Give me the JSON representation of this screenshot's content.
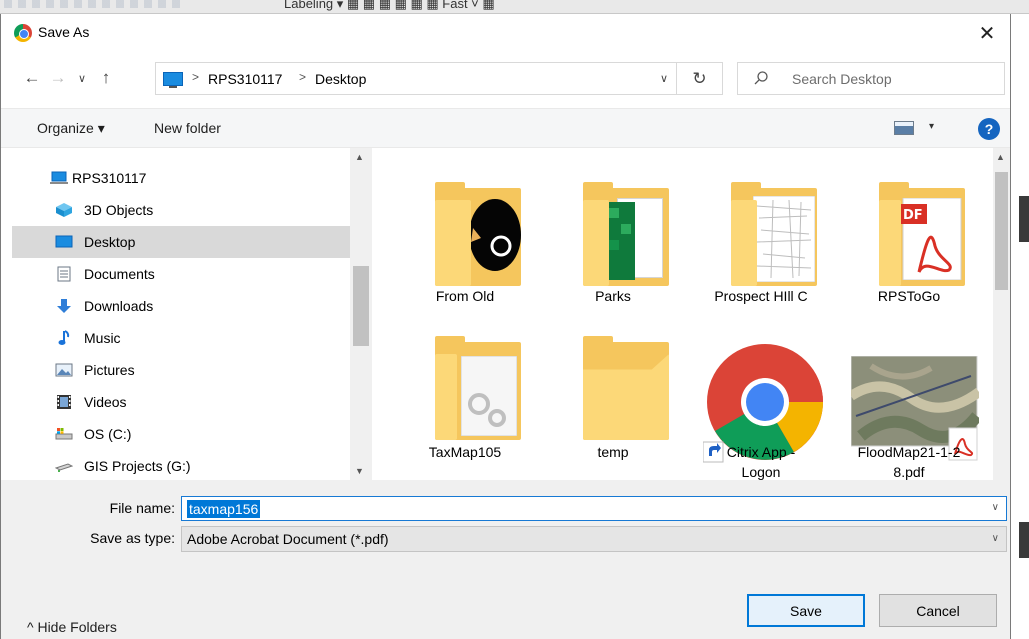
{
  "backdrop": {
    "text": "Labeling ▾   ▦  ▦  ▦  ▦  ▦  ▦  Fast     ˅ ▦"
  },
  "window": {
    "title": "Save As",
    "close_label": "✕"
  },
  "address_bar": {
    "crumbs": [
      "RPS310117",
      "Desktop"
    ],
    "separator": ">",
    "back_icon": "←",
    "forward_icon": "→",
    "dropdown_icon": "∨",
    "up_icon": "↑",
    "refresh_icon": "↻",
    "expand_icon": "∨"
  },
  "search": {
    "placeholder": "Search Desktop"
  },
  "toolbar": {
    "organize_label": "Organize ▾",
    "new_folder_label": "New folder",
    "help_label": "?",
    "view_drop": "▾"
  },
  "nav_pane": {
    "items": [
      {
        "label": "RPS310117",
        "icon": "computer-icon",
        "selected": false
      },
      {
        "label": "3D Objects",
        "icon": "cube-icon",
        "selected": false
      },
      {
        "label": "Desktop",
        "icon": "desktop-icon",
        "selected": true
      },
      {
        "label": "Documents",
        "icon": "document-icon",
        "selected": false
      },
      {
        "label": "Downloads",
        "icon": "download-icon",
        "selected": false
      },
      {
        "label": "Music",
        "icon": "music-icon",
        "selected": false
      },
      {
        "label": "Pictures",
        "icon": "pictures-icon",
        "selected": false
      },
      {
        "label": "Videos",
        "icon": "videos-icon",
        "selected": false
      },
      {
        "label": "OS (C:)",
        "icon": "drive-icon",
        "selected": false
      },
      {
        "label": "GIS Projects (G:)",
        "icon": "network-drive-icon",
        "selected": false
      }
    ]
  },
  "files": [
    {
      "label": "From Old",
      "icon": "folder-icon"
    },
    {
      "label": "Parks",
      "icon": "folder-icon"
    },
    {
      "label": "Prospect HIll C",
      "icon": "folder-icon"
    },
    {
      "label": "RPSToGo",
      "icon": "folder-icon"
    },
    {
      "label": "TaxMap105",
      "icon": "folder-icon"
    },
    {
      "label": "temp",
      "icon": "folder-icon"
    },
    {
      "label": "Citrix App -\nLogon",
      "icon": "chrome-shortcut-icon"
    },
    {
      "label": "FloodMap21-1-2\n8.pdf",
      "icon": "pdf-thumbnail-icon"
    }
  ],
  "form": {
    "file_name_label": "File name:",
    "file_name_value": "taxmap156",
    "save_type_label": "Save as type:",
    "save_type_value": "Adobe Acrobat Document (*.pdf)",
    "hide_folders_label": "^  Hide Folders",
    "save_label": "Save",
    "cancel_label": "Cancel",
    "chevron": "∨"
  },
  "colors": {
    "selection_blue": "#0078d7",
    "folder_yellow": "#fcd878",
    "help_blue": "#1565c0"
  }
}
